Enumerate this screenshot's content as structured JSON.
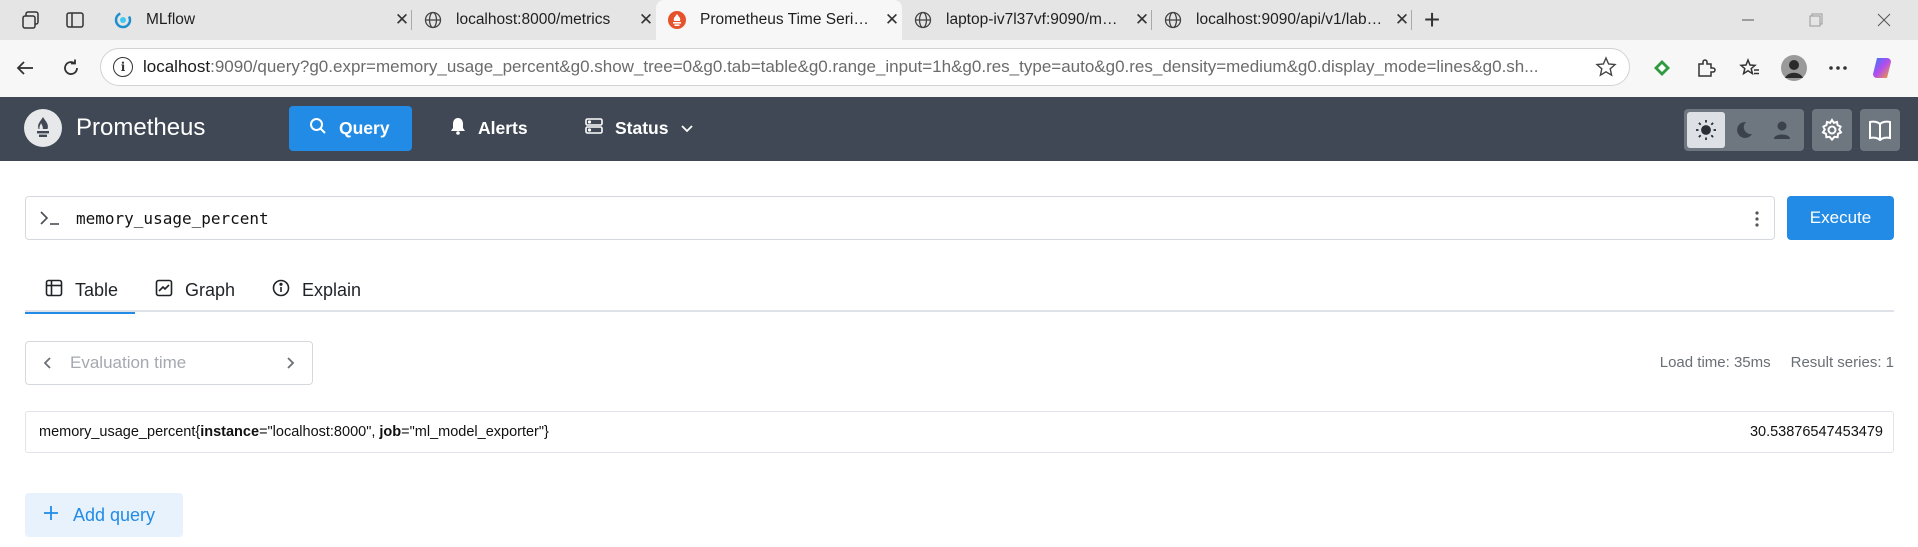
{
  "browser": {
    "tabs": [
      {
        "title": "MLflow",
        "icon": "mlflow-icon"
      },
      {
        "title": "localhost:8000/metrics",
        "icon": "globe-icon"
      },
      {
        "title": "Prometheus Time Series Collection",
        "icon": "prometheus-icon",
        "active": true
      },
      {
        "title": "laptop-iv7l37vf:9090/metrics",
        "icon": "globe-icon"
      },
      {
        "title": "localhost:9090/api/v1/label/__name",
        "icon": "globe-icon"
      }
    ],
    "url_host": "localhost",
    "url_rest": ":9090/query?g0.expr=memory_usage_percent&g0.show_tree=0&g0.tab=table&g0.range_input=1h&g0.res_type=auto&g0.res_density=medium&g0.display_mode=lines&g0.sh..."
  },
  "app": {
    "name": "Prometheus",
    "nav": {
      "query": "Query",
      "alerts": "Alerts",
      "status": "Status"
    }
  },
  "query": {
    "expression": "memory_usage_percent",
    "execute_label": "Execute"
  },
  "panel_tabs": {
    "table": "Table",
    "graph": "Graph",
    "explain": "Explain"
  },
  "eval_time": {
    "placeholder": "Evaluation time"
  },
  "stats": {
    "load_time": "Load time: 35ms",
    "result_series": "Result series: 1"
  },
  "result": {
    "metric": "memory_usage_percent",
    "label1_key": "instance",
    "label1_val": "\"localhost:8000\"",
    "label2_key": "job",
    "label2_val": "\"ml_model_exporter\"",
    "value": "30.53876547453479"
  },
  "add_query_label": "Add query",
  "colors": {
    "accent": "#228be6",
    "header": "#3f4854"
  }
}
